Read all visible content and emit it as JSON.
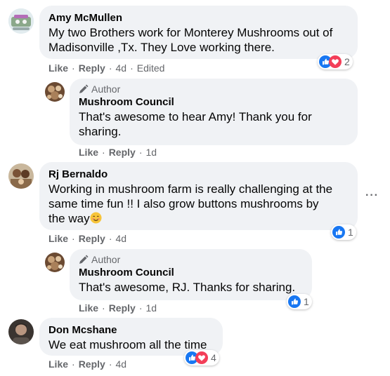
{
  "comments": [
    {
      "name": "Amy McMullen",
      "text": "My two Brothers work for Monterey Mushrooms out of Madisonville ,Tx. They Love working there.",
      "like": "Like",
      "reply": "Reply",
      "time": "4d",
      "edited": "Edited",
      "reaction_count": "2",
      "reactions": [
        "like-icon",
        "love-icon"
      ]
    },
    {
      "author_badge": "Author",
      "name": "Mushroom Council",
      "text_line1": "That's awesome to hear Amy! Thank you for",
      "text_line2": "sharing.",
      "like": "Like",
      "reply": "Reply",
      "time": "1d"
    },
    {
      "name": "Rj Bernaldo",
      "text_line1": "Working in mushroom farm is really challenging at the",
      "text_line2": "same time fun !! I also grow buttons mushrooms by",
      "text_line3": "the way",
      "emoji": "smiling-face-emoji",
      "like": "Like",
      "reply": "Reply",
      "time": "4d",
      "reaction_count": "1",
      "reactions": [
        "like-icon"
      ]
    },
    {
      "author_badge": "Author",
      "name": "Mushroom Council",
      "text": "That's awesome, RJ. Thanks for sharing.",
      "like": "Like",
      "reply": "Reply",
      "time": "1d",
      "reaction_count": "1",
      "reactions": [
        "like-icon"
      ]
    },
    {
      "name": "Don Mcshane",
      "text": "We eat mushroom all the time",
      "like": "Like",
      "reply": "Reply",
      "time": "4d",
      "reaction_count": "4",
      "reactions": [
        "like-icon",
        "love-icon"
      ]
    }
  ],
  "separator": "·",
  "more_menu": "···",
  "colors": {
    "bubble": "#f0f2f5",
    "like_blue": "#1877f2",
    "love_red": "#f33e58",
    "meta_gray": "#65676b"
  }
}
